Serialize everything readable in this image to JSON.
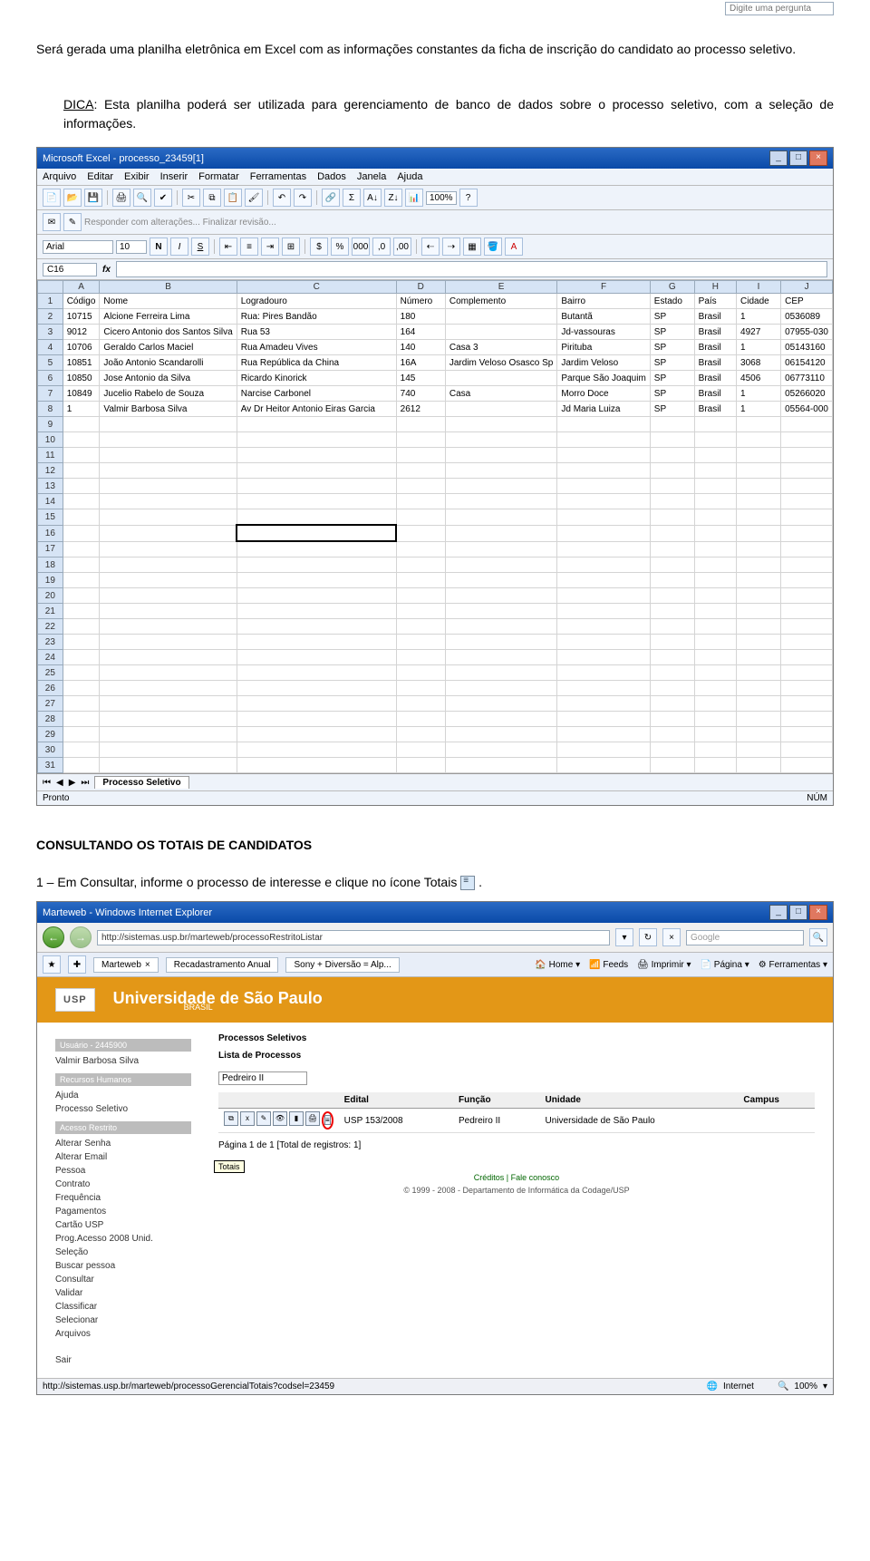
{
  "intro": "Será gerada uma planilha eletrônica em Excel com as informações constantes da ficha de inscrição do candidato ao processo seletivo.",
  "dica_label": "DICA",
  "dica_text": ": Esta planilha poderá ser utilizada para gerenciamento de banco de dados sobre o processo seletivo, com a seleção de informações.",
  "excel": {
    "title": "Microsoft Excel - processo_23459[1]",
    "ask": "Digite uma pergunta",
    "menus": [
      "Arquivo",
      "Editar",
      "Exibir",
      "Inserir",
      "Formatar",
      "Ferramentas",
      "Dados",
      "Janela",
      "Ajuda"
    ],
    "review": "Responder com alterações...  Finalizar revisão...",
    "font": "Arial",
    "size": "10",
    "zoom": "100%",
    "namebox": "C16",
    "columns": [
      "A",
      "B",
      "C",
      "D",
      "E",
      "F",
      "G",
      "H",
      "I",
      "J"
    ],
    "headers": [
      "Código",
      "Nome",
      "Logradouro",
      "Número",
      "Complemento",
      "Bairro",
      "Estado",
      "País",
      "Cidade",
      "CEP"
    ],
    "rows": [
      [
        "10715",
        "Alcione Ferreira Lima",
        "Rua: Pires Bandão",
        "180",
        "",
        "Butantã",
        "SP",
        "Brasil",
        "1",
        "0536089"
      ],
      [
        "9012",
        "Cicero Antonio dos Santos Silva",
        "Rua 53",
        "164",
        "",
        "Jd-vassouras",
        "SP",
        "Brasil",
        "4927",
        "07955-030"
      ],
      [
        "10706",
        "Geraldo Carlos Maciel",
        "Rua Amadeu Vives",
        "140",
        "Casa 3",
        "Pirituba",
        "SP",
        "Brasil",
        "1",
        "05143160"
      ],
      [
        "10851",
        "João Antonio Scandarolli",
        "Rua República da China",
        "16A",
        "Jardim Veloso Osasco Sp",
        "Jardim Veloso",
        "SP",
        "Brasil",
        "3068",
        "06154120"
      ],
      [
        "10850",
        "Jose Antonio da Silva",
        "Ricardo Kinorick",
        "145",
        "",
        "Parque São Joaquim",
        "SP",
        "Brasil",
        "4506",
        "06773110"
      ],
      [
        "10849",
        "Jucelio Rabelo de Souza",
        "Narcise Carbonel",
        "740",
        "Casa",
        "Morro Doce",
        "SP",
        "Brasil",
        "1",
        "05266020"
      ],
      [
        "1",
        "Valmir Barbosa Silva",
        "Av Dr Heitor Antonio Eiras Garcia",
        "2612",
        "",
        "Jd Maria Luiza",
        "SP",
        "Brasil",
        "1",
        "05564-000"
      ]
    ],
    "tab": "Processo Seletivo",
    "status_left": "Pronto",
    "status_right": "NÚM"
  },
  "heading2": "CONSULTANDO OS TOTAIS DE CANDIDATOS",
  "step1": "1 – Em Consultar, informe o processo de interesse e clique no ícone Totais ",
  "step1_end": ".",
  "ie": {
    "title": "Marteweb - Windows Internet Explorer",
    "url": "http://sistemas.usp.br/marteweb/processoRestritoListar",
    "search_hint": "Google",
    "tabs": [
      "Marteweb",
      "Recadastramento Anual",
      "Sony + Diversão = Alp..."
    ],
    "links": [
      "Home",
      "Feeds",
      "Imprimir",
      "Página",
      "Ferramentas"
    ],
    "banner": "Universidade de São Paulo",
    "brasil": "BRASIL",
    "left": {
      "user_box": "Usuário - 2445900",
      "user_name": "Valmir Barbosa Silva",
      "groups": [
        {
          "title": "Recursos Humanos",
          "items": [
            "Ajuda",
            "Processo Seletivo"
          ]
        },
        {
          "title": "Acesso Restrito",
          "items": [
            "Alterar Senha",
            "Alterar Email",
            "Pessoa",
            "Contrato",
            "Frequência",
            "Pagamentos",
            "Cartão USP",
            "Prog.Acesso 2008 Unid.",
            "Seleção",
            "  Buscar pessoa",
            "  Consultar",
            "  Validar",
            "  Classificar",
            "  Selecionar",
            "Arquivos"
          ]
        }
      ],
      "sair": "Sair"
    },
    "main": {
      "breadcrumb": "Processos Seletivos",
      "heading": "Lista de Processos",
      "filter_value": "Pedreiro II",
      "cols": [
        "Edital",
        "Função",
        "Unidade",
        "Campus"
      ],
      "row": {
        "edital": "USP 153/2008",
        "funcao": "Pedreiro II",
        "unidade": "Universidade de São Paulo",
        "campus": ""
      },
      "tooltip": "Totais",
      "pager": "Página 1 de 1   [Total de registros: 1]"
    },
    "credits": "Créditos | Fale conosco",
    "copyright": "© 1999 - 2008 - Departamento de Informática da Codage/USP",
    "status_url": "http://sistemas.usp.br/marteweb/processoGerencialTotais?codsel=23459",
    "status_zone": "Internet",
    "status_zoom": "100%"
  }
}
